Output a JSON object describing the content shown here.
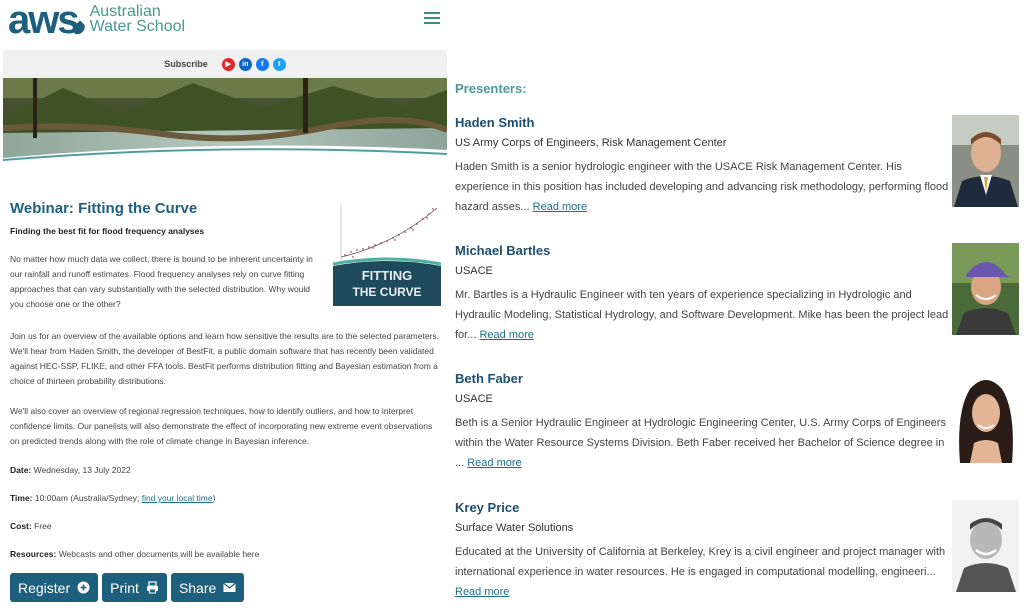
{
  "header": {
    "logo_mark": "aws",
    "logo_line1": "Australian",
    "logo_line2": "Water School"
  },
  "subscribe": {
    "label": "Subscribe",
    "icons": [
      "youtube-icon",
      "linkedin-icon",
      "facebook-icon",
      "twitter-icon"
    ],
    "colors": {
      "youtube": "#e02a2a",
      "linkedin": "#0a66c2",
      "facebook": "#1877f2",
      "twitter": "#1da1f2"
    }
  },
  "webinar": {
    "title": "Webinar: Fitting the Curve",
    "subtitle": "Finding the best fit for flood frequency analyses",
    "thumb_line1": "FITTING",
    "thumb_line2": "THE CURVE",
    "para1": "No matter how much data we collect, there is bound to be inherent uncertainty in our rainfall and runoff estimates. Flood frequency analyses rely on curve fitting approaches that can vary substantially with the selected distribution. Why would you choose one or the other?",
    "para2": "Join us for an overview of the available options and learn how sensitive the results are to the selected parameters. We'll hear from Haden Smith, the developer of BestFit, a public domain software that has recently been validated against HEC-SSP, FLIKE, and other FFA tools. BestFit performs distribution fitting and Bayesian estimation from a choice of thirteen probability distributions.",
    "para3": "We'll also cover an overview of regional regression techniques, how to identify outliers, and how to interpret confidence limits. Our panelists will also demonstrate the effect of incorporating new extreme event observations on predicted trends along with the role of climate change in Bayesian inference.",
    "date_label": "Date:",
    "date_value": "Wednesday, 13 July 2022",
    "time_label": "Time:",
    "time_value": "10:00am (Australia/Sydney;",
    "time_link": "find your local time",
    "time_close": ")",
    "cost_label": "Cost:",
    "cost_value": "Free",
    "resources_label": "Resources:",
    "resources_value": "Webcasts and other documents will be available here"
  },
  "actions": {
    "register": "Register",
    "print": "Print",
    "share": "Share"
  },
  "presenters_heading": "Presenters:",
  "presenters": [
    {
      "name": "Haden Smith",
      "org": "US Army Corps of Engineers, Risk Management Center",
      "bio": "Haden Smith is a senior hydrologic engineer with the USACE Risk Management Center. His experience in this position has included developing and advancing risk methodology, performing flood hazard asses...",
      "more": "Read more"
    },
    {
      "name": "Michael Bartles",
      "org": "USACE",
      "bio": "Mr. Bartles is a Hydraulic Engineer with ten years of experience specializing in Hydrologic and Hydraulic Modeling, Statistical Hydrology, and Software Development. Mike has been the project lead for...",
      "more": "Read more"
    },
    {
      "name": "Beth Faber",
      "org": "USACE",
      "bio": "Beth is a Senior Hydraulic Engineer at Hydrologic Engineering Center, U.S. Army Corps of Engineers within the Water Resource Systems Division. Beth Faber received her Bachelor of Science degree in ...",
      "more": "Read more"
    },
    {
      "name": "Krey Price",
      "org": "Surface Water Solutions",
      "bio": "Educated at the University of California at Berkeley, Krey is a civil engineer and project manager with international experience in water resources. He is engaged in computational modelling, engineeri...",
      "more": "Read more"
    }
  ]
}
